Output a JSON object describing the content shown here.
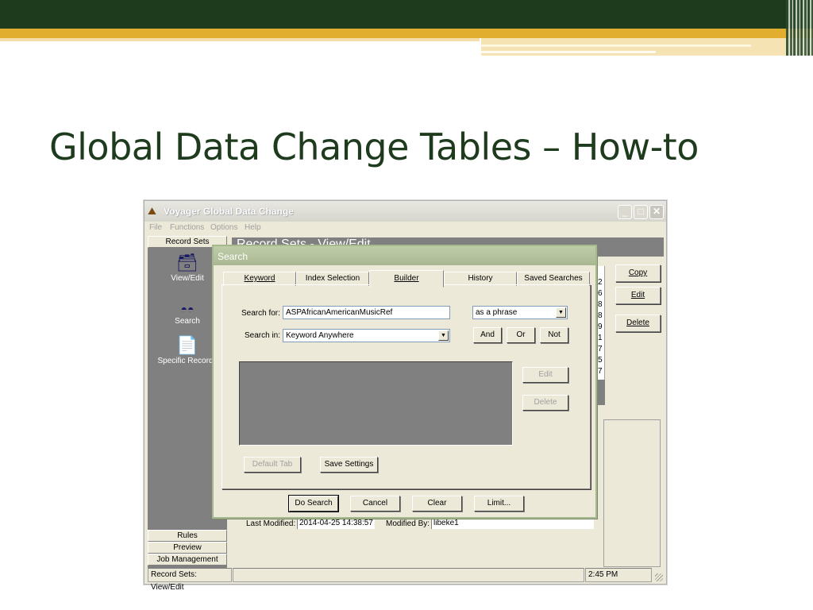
{
  "slide": {
    "title": "Global Data Change Tables – How-to"
  },
  "window": {
    "title": "Voyager Global Data Change",
    "icon": "app-icon",
    "menu": [
      "File",
      "Functions",
      "Options",
      "Help"
    ],
    "left_tabs": {
      "top": "Record Sets",
      "bottom": [
        "Rules",
        "Preview",
        "Job Management"
      ]
    },
    "nav": [
      {
        "label": "View/Edit",
        "icon": "card-file-icon"
      },
      {
        "label": "Search",
        "icon": "binoculars-icon"
      },
      {
        "label": "Specific Records",
        "icon": "document-list-icon"
      }
    ],
    "header_title": "Record Sets - View/Edit",
    "right_buttons": [
      "Copy",
      "Edit",
      "Delete"
    ],
    "list_peek": [
      "2",
      "6",
      "8",
      "8",
      "9",
      "1",
      "7",
      "5",
      "7"
    ],
    "last_modified_label": "Last Modified:",
    "last_modified_value": "2014-04-25 14:38:57",
    "modified_by_label": "Modified By:",
    "modified_by_value": "libeke1",
    "status": {
      "section": "Record Sets:  View/Edit",
      "time": "2:45 PM"
    }
  },
  "dialog": {
    "title": "Search",
    "tabs": [
      "Keyword",
      "Index Selection",
      "Builder",
      "History",
      "Saved Searches"
    ],
    "active_tab": "Builder",
    "search_for_label": "Search for:",
    "search_for_value": "ASPAfricanAmericanMusicRef",
    "match_option": "as a phrase",
    "search_in_label": "Search in:",
    "search_in_value": "Keyword Anywhere",
    "bool_buttons": [
      "And",
      "Or",
      "Not"
    ],
    "side_buttons": [
      "Edit",
      "Delete"
    ],
    "default_tab_label": "Default Tab",
    "save_settings_label": "Save Settings",
    "footer_buttons": [
      "Do Search",
      "Cancel",
      "Clear",
      "Limit..."
    ]
  },
  "colors": {
    "slide_green": "#1e3b1e",
    "slide_gold": "#e2ae2f",
    "dialog_title": "#a9b893",
    "panel_grey": "#808080"
  }
}
